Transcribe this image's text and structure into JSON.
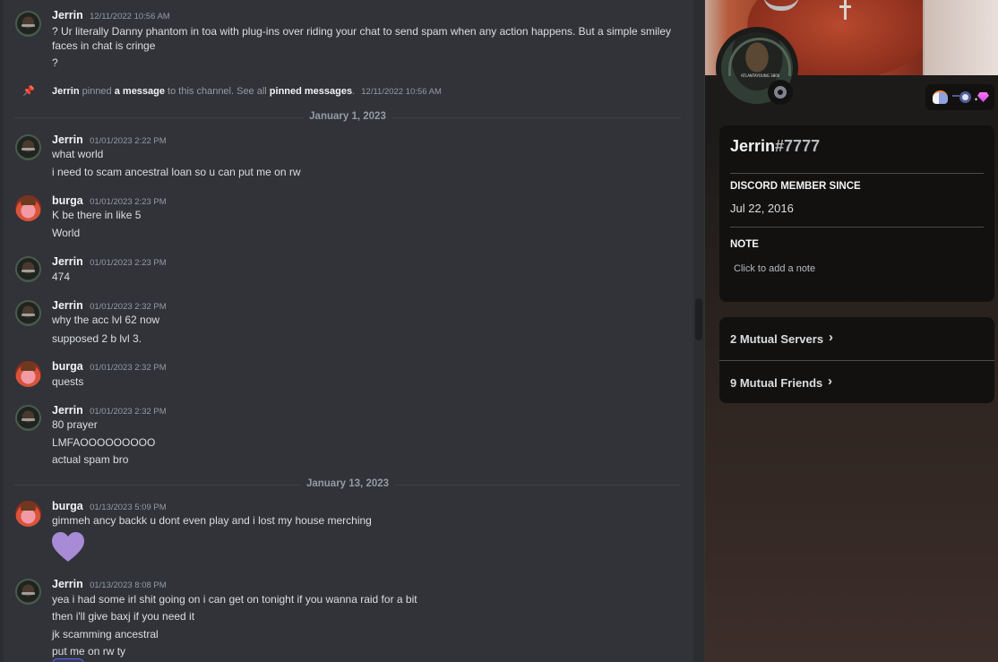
{
  "chat": {
    "top_message": {
      "author": "Jerrin",
      "timestamp": "12/11/2022 10:56 AM",
      "lines": [
        "? Ur literally Danny phantom in toa with plug-ins over riding your chat to send spam when any action happens. But a simple smiley",
        "faces in chat is cringe",
        "?"
      ]
    },
    "pin_notice": {
      "actor": "Jerrin",
      "text1": " pinned ",
      "link1": "a message",
      "text2": " to this channel. See all ",
      "link2": "pinned messages",
      "text3": ".",
      "timestamp": "12/11/2022 10:56 AM"
    },
    "dividers": [
      "January 1, 2023",
      "January 13, 2023"
    ],
    "messages": [
      {
        "author": "Jerrin",
        "avatar": "jerrin",
        "timestamp": "01/01/2023 2:22 PM",
        "lines": [
          "what world",
          "i need to scam ancestral loan so u can put me on rw"
        ]
      },
      {
        "author": "burga",
        "avatar": "burga",
        "timestamp": "01/01/2023 2:23 PM",
        "lines": [
          "K be there in like 5",
          "World"
        ]
      },
      {
        "author": "Jerrin",
        "avatar": "jerrin",
        "timestamp": "01/01/2023 2:23 PM",
        "lines": [
          "474"
        ]
      },
      {
        "author": "Jerrin",
        "avatar": "jerrin",
        "timestamp": "01/01/2023 2:32 PM",
        "lines": [
          "why the acc lvl 62 now",
          "supposed 2 b lvl 3."
        ]
      },
      {
        "author": "burga",
        "avatar": "burga",
        "timestamp": "01/01/2023 2:32 PM",
        "lines": [
          "quests"
        ]
      },
      {
        "author": "Jerrin",
        "avatar": "jerrin",
        "timestamp": "01/01/2023 2:32 PM",
        "lines": [
          "80 prayer",
          "LMFAOOOOOOOOO",
          "actual spam bro"
        ]
      },
      {
        "author": "burga",
        "avatar": "burga",
        "timestamp": "01/13/2023 5:09 PM",
        "lines": [
          "gimmeh ancy backk u dont even play and i lost my house merching"
        ],
        "emoji": "purple-heart"
      },
      {
        "author": "Jerrin",
        "avatar": "jerrin",
        "timestamp": "01/13/2023 8:08 PM",
        "lines": [
          "yea i had some irl shit going on i can get on tonight if you wanna raid for a bit",
          "then i'll give baxj if you need it",
          "jk scamming ancestral",
          "put me on rw ty"
        ]
      }
    ],
    "heart_color": "#a78bd6"
  },
  "profile": {
    "username": "Jerrin",
    "discriminator": "#7777",
    "status": "offline",
    "avatar_caption": "ATLANTAYOUNG 3800",
    "badges": [
      "hypesquad-badge",
      "nitro-badge",
      "server-boost-badge"
    ],
    "member_since_label": "Discord Member Since",
    "member_since": "Jul 22, 2016",
    "note_label": "Note",
    "note_placeholder": "Click to add a note",
    "mutual_servers": "2 Mutual Servers",
    "mutual_friends": "9 Mutual Friends"
  }
}
